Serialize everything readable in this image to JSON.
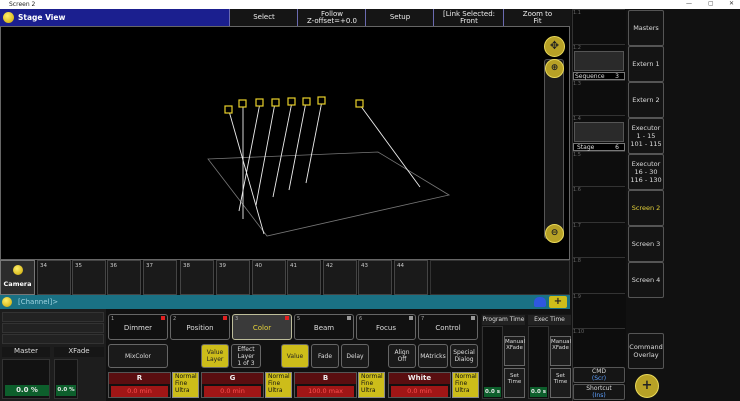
{
  "window": {
    "title": "Screen 2",
    "controls": [
      "—",
      "▢",
      "✕"
    ]
  },
  "stage_view": {
    "title": "Stage View",
    "toolbar": [
      {
        "label": "Select"
      },
      {
        "label": "Follow",
        "sub": "Z-offset=+0.0"
      },
      {
        "label": "Setup"
      },
      {
        "label": "[Link Selected: Front"
      },
      {
        "label": "Zoom to",
        "sub": "Fit"
      }
    ]
  },
  "executors": {
    "cells": [
      {
        "num": "1.1",
        "name": ""
      },
      {
        "num": "1.2",
        "name": "Sequence",
        "value": "3"
      },
      {
        "num": "1.3",
        "name": ""
      },
      {
        "num": "1.4",
        "name": "Stage",
        "value": "6"
      },
      {
        "num": "1.5",
        "name": ""
      },
      {
        "num": "1.6",
        "name": ""
      },
      {
        "num": "1.7",
        "name": ""
      },
      {
        "num": "1.8",
        "name": ""
      },
      {
        "num": "1.9",
        "name": ""
      },
      {
        "num": "1.10",
        "name": ""
      }
    ]
  },
  "right_buttons": [
    {
      "label": "Masters"
    },
    {
      "label": "Extern 1"
    },
    {
      "label": "Extern 2"
    },
    {
      "label": "Executor\n1 - 15\n101 - 115"
    },
    {
      "label": "Executor\n16 - 30\n116 - 130"
    },
    {
      "label": "Screen 2",
      "active": true
    },
    {
      "label": "Screen 3"
    },
    {
      "label": "Screen 4"
    },
    {
      "label": "Command\nOverlay"
    }
  ],
  "view_buttons": [
    {
      "label": "Camera",
      "active": true
    },
    {
      "num": "34"
    },
    {
      "num": "35"
    },
    {
      "num": "36"
    },
    {
      "num": "37"
    },
    {
      "num": "38"
    },
    {
      "num": "39"
    },
    {
      "num": "40"
    },
    {
      "num": "41"
    },
    {
      "num": "42"
    },
    {
      "num": "43"
    },
    {
      "num": "44"
    }
  ],
  "command_line": {
    "text": "[Channel]>"
  },
  "masters": {
    "master_label": "Master",
    "xfade_label": "XFade",
    "master_value": "0.0 %",
    "xfade_value": "0.0 %"
  },
  "feature_groups": [
    {
      "num": "1",
      "label": "Dimmer"
    },
    {
      "num": "2",
      "label": "Position"
    },
    {
      "num": "3",
      "label": "Color",
      "active": true
    },
    {
      "num": "5",
      "label": "Beam"
    },
    {
      "num": "6",
      "label": "Focus"
    },
    {
      "num": "7",
      "label": "Control"
    }
  ],
  "sub_buttons": {
    "mixcolor": "MixColor",
    "value_layer": "Value\nLayer",
    "effect_layer": "Effect\nLayer\n1 of 3",
    "value": "Value",
    "fade": "Fade",
    "delay": "Delay",
    "align_off": "Align\nOff",
    "matricks": "MAtricks",
    "special_dialog": "Special\nDialog"
  },
  "encoders": [
    {
      "name": "R",
      "value": "0.0 min",
      "mode": "Normal\nFine\nUltra"
    },
    {
      "name": "G",
      "value": "0.0 min",
      "mode": "Normal\nFine\nUltra"
    },
    {
      "name": "B",
      "value": "100.0 max",
      "mode": "Normal\nFine\nUltra"
    },
    {
      "name": "White",
      "value": "0.0 min",
      "mode": "Normal\nFine\nUltra"
    }
  ],
  "timing": {
    "program_time": "Program Time",
    "exec_time": "Exec Time",
    "manual_xfade": "Manual\nXFade",
    "set_time": "Set\nTime",
    "program_value": "0.0 s",
    "exec_value": "0.0 s"
  },
  "bottom_right": {
    "cmd": "CMD",
    "cmd_sub": "(Scr)",
    "shortcut": "Shortcut",
    "shortcut_sub": "(Ins)"
  },
  "colors": {
    "header_blue": "#1b1f8f",
    "accent_yellow": "#cdbd1a",
    "cmd_teal": "#1a7184",
    "encoder_red": "#a01616"
  }
}
